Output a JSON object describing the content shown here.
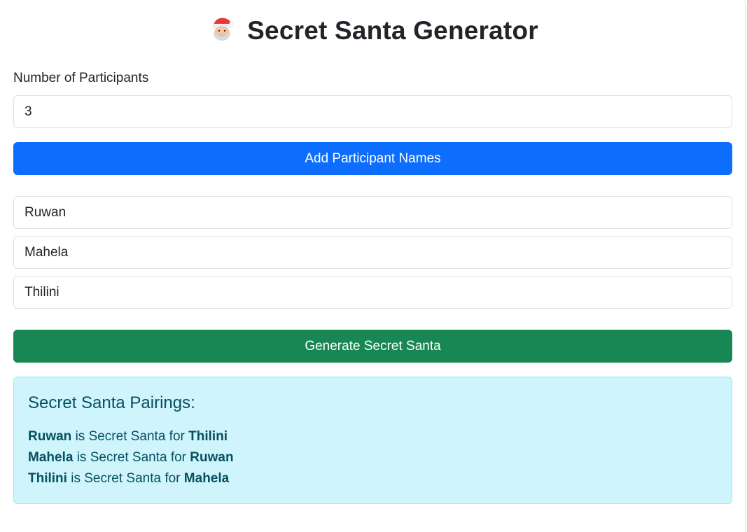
{
  "header": {
    "icon": "santa-icon",
    "title": "Secret Santa Generator"
  },
  "participants": {
    "label": "Number of Participants",
    "count": "3",
    "add_button": "Add Participant Names",
    "names": [
      "Ruwan",
      "Mahela",
      "Thilini"
    ]
  },
  "generate_button": "Generate Secret Santa",
  "results": {
    "heading": "Secret Santa Pairings:",
    "connector": "is Secret Santa for",
    "pairs": [
      {
        "giver": "Ruwan",
        "receiver": "Thilini"
      },
      {
        "giver": "Mahela",
        "receiver": "Ruwan"
      },
      {
        "giver": "Thilini",
        "receiver": "Mahela"
      }
    ]
  },
  "colors": {
    "primary": "#0d6efd",
    "success": "#198754",
    "info_bg": "#cff4fc",
    "info_text": "#055160"
  }
}
